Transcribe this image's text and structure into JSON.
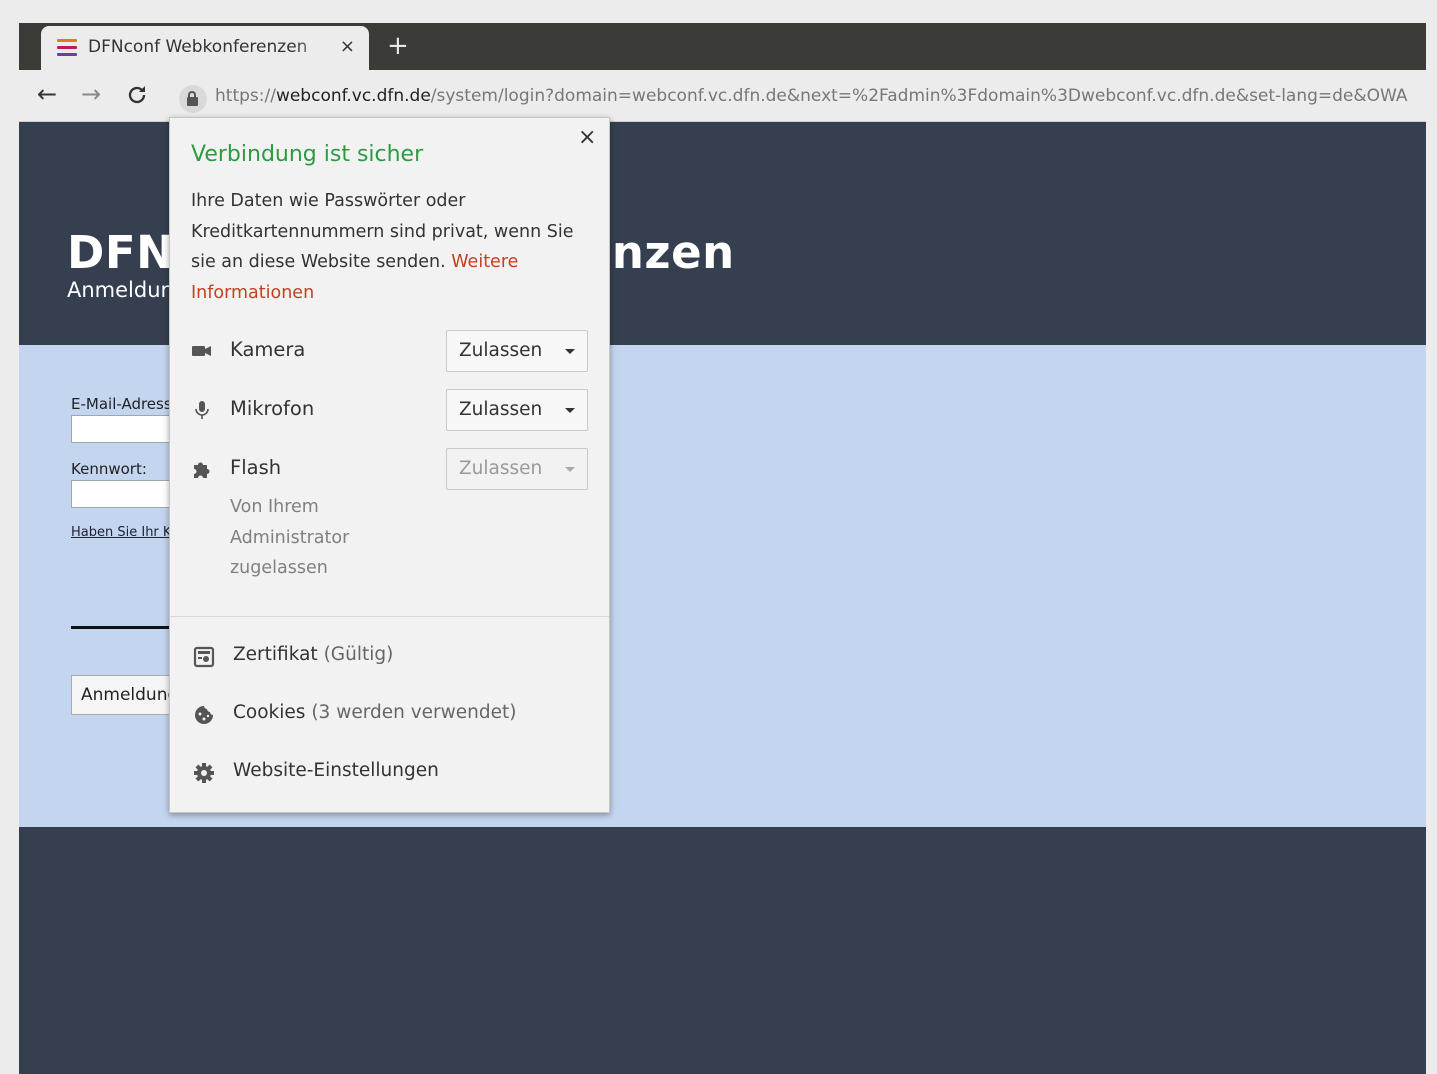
{
  "browser": {
    "tab_title": "DFNconf Webkonferenzen",
    "tab_close": "×",
    "new_tab": "+",
    "nav": {
      "back": "←",
      "forward": "→",
      "reload": "C"
    },
    "url": {
      "scheme": "https://",
      "host": "webconf.vc.dfn.de",
      "path": "/system/login?domain=webconf.vc.dfn.de&next=%2Fadmin%3Fdomain%3Dwebconf.vc.dfn.de&set-lang=de&OWA"
    }
  },
  "page": {
    "title": "DFNconf Webkonferenzen",
    "subtitle": "Anmeldung",
    "email_label": "E-Mail-Adresse:",
    "password_label": "Kennwort:",
    "forgot_link": "Haben Sie Ihr Kennwort vergessen?",
    "login_button": "Anmeldung"
  },
  "popup": {
    "close": "×",
    "title": "Verbindung ist sicher",
    "description": "Ihre Daten wie Passwörter oder Kreditkartennummern sind privat, wenn Sie sie an diese Website senden.",
    "more_info": "Weitere Informationen",
    "permissions": [
      {
        "label": "Kamera",
        "value": "Zulassen",
        "icon": "camera-icon"
      },
      {
        "label": "Mikrofon",
        "value": "Zulassen",
        "icon": "microphone-icon"
      },
      {
        "label": "Flash",
        "value": "Zulassen",
        "icon": "puzzle-icon",
        "disabled": true
      }
    ],
    "flash_note": "Von Ihrem Administrator zugelassen",
    "links": {
      "certificate": "Zertifikat",
      "certificate_note": "(Gültig)",
      "cookies": "Cookies",
      "cookies_note": "(3 werden verwendet)",
      "site_settings": "Website-Einstellungen"
    }
  },
  "colors": {
    "header_bg": "#353f4f",
    "content_bg": "#c3d5ef",
    "secure_green": "#2f9a44",
    "link_red": "#c5401e"
  }
}
